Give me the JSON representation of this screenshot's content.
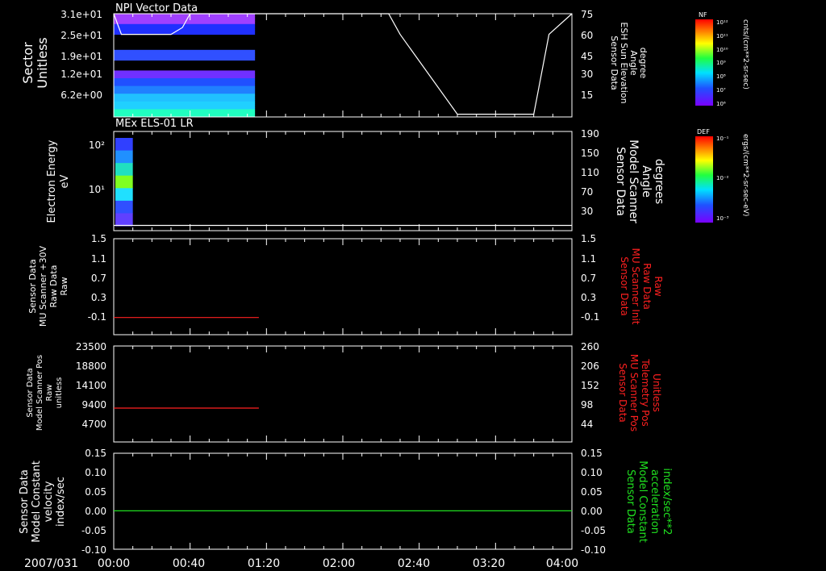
{
  "date_label": "2007/031",
  "time_ticks": [
    "00:00",
    "00:40",
    "01:20",
    "02:00",
    "02:40",
    "03:20",
    "04:00"
  ],
  "time_range_min": [
    0,
    240
  ],
  "colors": {
    "background": "#000000",
    "axis": "#ffffff",
    "red": "#ff2020",
    "green": "#20e020"
  },
  "panels": [
    {
      "title": "NPI Vector Data",
      "left_label": [
        "Sector",
        "Unitless"
      ],
      "left_ticks": [
        "3.1e+01",
        "2.5e+01",
        "1.9e+01",
        "1.2e+01",
        "6.2e+00"
      ],
      "right_label": [
        "Sensor Data",
        "ESH Sun Elevation",
        "Angle",
        "degree"
      ],
      "right_ticks": [
        "75",
        "60",
        "45",
        "30",
        "15"
      ],
      "right_range": [
        0,
        75
      ]
    },
    {
      "title": "MEx ELS-01 LR",
      "left_label": [
        "Electron Energy",
        "eV"
      ],
      "left_ticks": [
        "10²",
        "10¹"
      ],
      "right_label": [
        "Sensor Data",
        "Model Scanner",
        "Angle",
        "degrees"
      ],
      "right_ticks": [
        "190",
        "150",
        "110",
        "70",
        "30"
      ],
      "right_range": [
        0,
        190
      ]
    },
    {
      "title": "",
      "left_label": [
        "Sensor Data",
        "MU Scanner +30V",
        "Raw Data",
        "Raw"
      ],
      "left_ticks": [
        "1.5",
        "1.1",
        "0.7",
        "0.3",
        "-0.1"
      ],
      "right_label": [
        "Sensor Data",
        "MU Scanner Init",
        "Raw Data",
        "Raw"
      ],
      "right_ticks": [
        "1.5",
        "1.1",
        "0.7",
        "0.3",
        "-0.1"
      ],
      "right_range": [
        -0.4,
        1.5
      ]
    },
    {
      "title": "",
      "left_label": [
        "Sensor Data",
        "Model Scanner Pos",
        "Raw",
        "unitless"
      ],
      "left_ticks": [
        "23500",
        "18800",
        "14100",
        "9400",
        "4700"
      ],
      "right_label": [
        "Sensor Data",
        "MU Scanner Pos",
        "Telemetry Pos",
        "Unitless"
      ],
      "right_ticks": [
        "260",
        "206",
        "152",
        "98",
        "44"
      ],
      "right_range": [
        0,
        260
      ]
    },
    {
      "title": "",
      "left_label": [
        "Sensor Data",
        "Model Constant",
        "velocity",
        "index/sec"
      ],
      "left_ticks": [
        "0.15",
        "0.10",
        "0.05",
        "0.00",
        "-0.05",
        "-0.10"
      ],
      "right_label": [
        "Sensor Data",
        "Model Constant",
        "acceleration",
        "index/sec**2"
      ],
      "right_ticks": [
        "0.15",
        "0.10",
        "0.05",
        "0.00",
        "-0.05",
        "-0.10"
      ],
      "right_range": [
        -0.1,
        0.15
      ]
    }
  ],
  "colorbars": [
    {
      "title": "NF",
      "unit": "cnts/(cm**2-sr-sec)",
      "ticks": [
        "10¹²",
        "10¹¹",
        "10¹⁰",
        "10⁹",
        "10⁸",
        "10⁷",
        "10⁶"
      ]
    },
    {
      "title": "DEF",
      "unit": "ergs/(cm**2-sr-sec-eV)",
      "ticks": [
        "10⁻¹",
        "10⁻²",
        "10⁻³"
      ]
    }
  ],
  "chart_data": [
    {
      "type": "line",
      "panel": 0,
      "series": [
        {
          "axis": "right",
          "color": "#ffffff",
          "x": [
            0,
            4,
            10,
            30,
            36,
            40,
            144,
            150,
            180,
            184,
            190,
            220,
            228,
            240
          ],
          "y": [
            75,
            60,
            60,
            60,
            65,
            75,
            75,
            60,
            2,
            2,
            2,
            2,
            60,
            75
          ]
        }
      ],
      "heatmap_extent_min": [
        0,
        74
      ]
    },
    {
      "type": "line",
      "panel": 1,
      "series": [
        {
          "axis": "right",
          "color": "#ffffff",
          "x": [
            0,
            240
          ],
          "y": [
            10,
            10
          ]
        }
      ],
      "heatmap_extent_min": [
        0,
        10
      ]
    },
    {
      "type": "line",
      "panel": 2,
      "series": [
        {
          "axis": "left",
          "color": "#ff2020",
          "x": [
            0,
            76
          ],
          "y": [
            -0.06,
            -0.06
          ]
        }
      ]
    },
    {
      "type": "line",
      "panel": 3,
      "series": [
        {
          "axis": "left",
          "color": "#ff2020",
          "x": [
            0,
            76
          ],
          "y": [
            8300,
            8300
          ]
        }
      ]
    },
    {
      "type": "line",
      "panel": 4,
      "series": [
        {
          "axis": "left",
          "color": "#20e020",
          "x": [
            0,
            240
          ],
          "y": [
            0,
            0
          ]
        }
      ]
    }
  ]
}
